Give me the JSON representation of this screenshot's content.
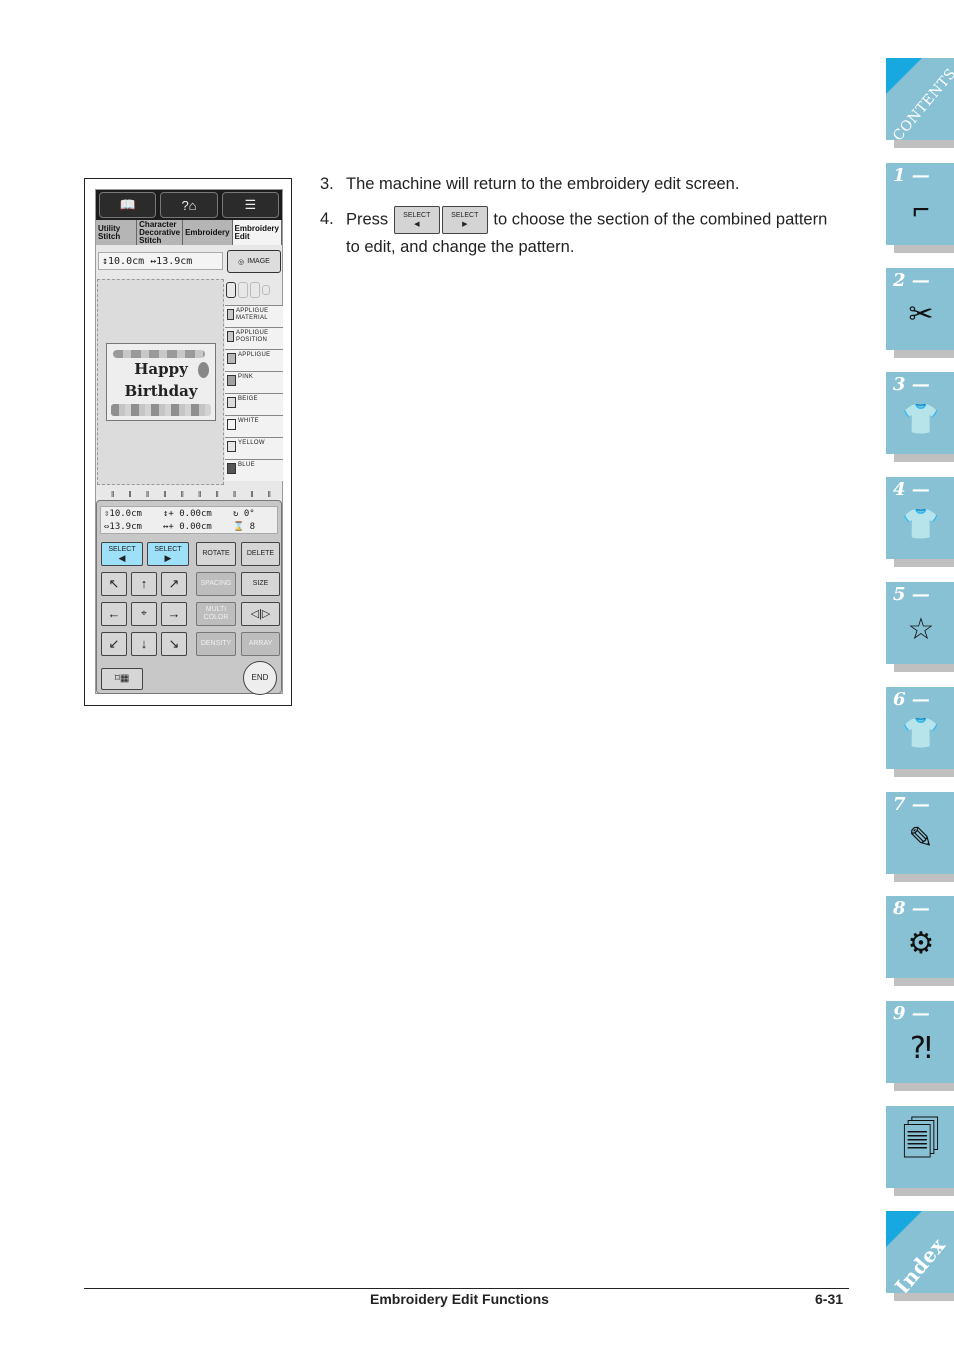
{
  "screen": {
    "top_icons": [
      "reference-book-icon",
      "help-machine-icon",
      "pattern-list-icon"
    ],
    "tabs": [
      {
        "label": "Utility Stitch",
        "active": false
      },
      {
        "label": "Character Decorative Stitch",
        "active": false
      },
      {
        "label": "Embroidery",
        "active": false
      },
      {
        "label": "Embroidery Edit",
        "active": true
      }
    ],
    "size_readout": "↕10.0cm ↔13.9cm",
    "image_button": "IMAGE",
    "pattern_text": [
      "Happy",
      "Birthday"
    ],
    "thread_colors": [
      {
        "name": "APPLIGUE MATERIAL",
        "color": "#c8c8c8"
      },
      {
        "name": "APPLIGUE POSITION",
        "color": "#c8c8c8"
      },
      {
        "name": "APPLIGUE",
        "color": "#b8b8b8"
      },
      {
        "name": "PINK",
        "color": "#a0a0a0"
      },
      {
        "name": "BEIGE",
        "color": "#dcdcdc"
      },
      {
        "name": "WHITE",
        "color": "#f4f4f4"
      },
      {
        "name": "YELLOW",
        "color": "#e6e6e6"
      },
      {
        "name": "BLUE",
        "color": "#555555"
      }
    ],
    "readout": {
      "height": "10.0cm",
      "width": "13.9cm",
      "vertical_offset": "0.00cm",
      "horizontal_offset": "0.00cm",
      "rotation": "0°",
      "color_count": "8"
    },
    "buttons": {
      "select_left": "SELECT",
      "select_right": "SELECT",
      "rotate": "ROTATE",
      "delete": "DELETE",
      "spacing": "SPACING",
      "size": "SIZE",
      "multi_color": "MULTI COLOR",
      "density": "DENSITY",
      "array": "ARRAY",
      "end": "END"
    }
  },
  "steps": [
    {
      "num": "3.",
      "text": "The machine will return to the embroidery edit screen."
    },
    {
      "num": "4.",
      "pre": "Press",
      "post": "to choose the section of the combined pattern",
      "line2": "to edit, and change the pattern.",
      "btn_label": "SELECT"
    }
  ],
  "side_tabs": [
    {
      "label": "CONTENTS",
      "type": "contents"
    },
    {
      "label": "1 —",
      "icon": "sewing-machine-icon"
    },
    {
      "label": "2 —",
      "icon": "thread-spool-scissors-icon"
    },
    {
      "label": "3 —",
      "icon": "tshirt-stitch-icon"
    },
    {
      "label": "4 —",
      "icon": "tshirt-abc-icon"
    },
    {
      "label": "5 —",
      "icon": "embroidery-frame-icon"
    },
    {
      "label": "6 —",
      "icon": "tshirt-letters-icon"
    },
    {
      "label": "7 —",
      "icon": "tshirt-pen-icon"
    },
    {
      "label": "8 —",
      "icon": "machine-maintenance-icon"
    },
    {
      "label": "9 —",
      "icon": "machine-trouble-icon"
    },
    {
      "label": "",
      "icon": "documents-icon"
    },
    {
      "label": "Index",
      "type": "index"
    }
  ],
  "footer": {
    "title": "Embroidery Edit Functions",
    "page": "6-31"
  }
}
